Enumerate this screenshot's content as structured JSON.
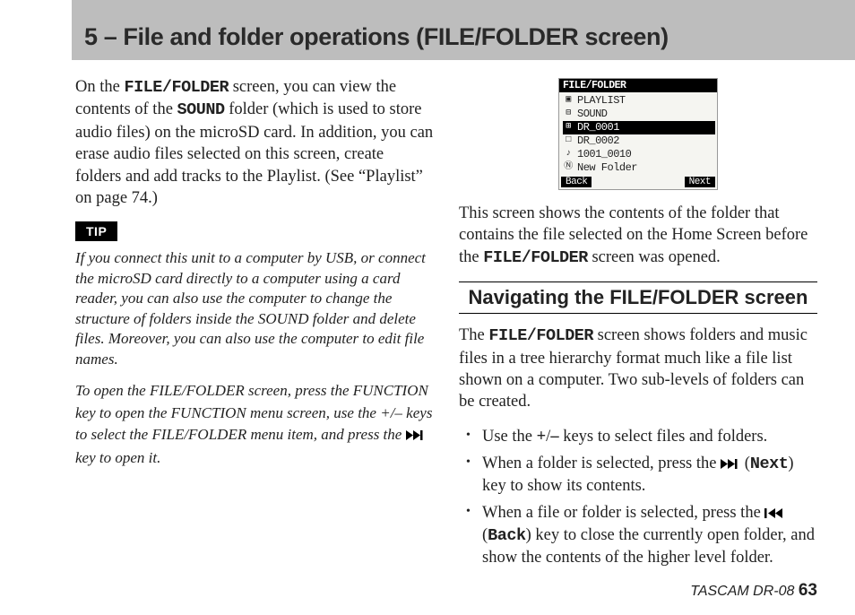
{
  "header": {
    "title": "5 – File and folder operations (FILE/FOLDER screen)"
  },
  "left": {
    "intro_pre": "On the ",
    "intro_mono1": "FILE/FOLDER",
    "intro_mid1": " screen, you can view the contents of the ",
    "intro_mono2": "SOUND",
    "intro_post": " folder (which is used to store audio files) on the microSD card. In addition, you can erase audio files selected on this screen, create folders and add tracks to the Playlist. (See “Playlist” on page 74.)",
    "tip_label": "TIP",
    "tip_body1": "If you connect this unit to a computer by USB, or connect the microSD card directly to a computer using a card reader, you can also use the computer to change the structure of folders inside the SOUND folder and delete files. Moreover, you can also use the computer to edit file names.",
    "tip_body2_pre": "To open the FILE/FOLDER screen, press the FUNCTION key to open the FUNCTION menu screen, use the +/– keys to select the FILE/FOLDER menu item, and press the ",
    "tip_body2_post": " key to open it."
  },
  "lcd": {
    "title": "FILE/FOLDER",
    "rows": [
      {
        "icon": "▣",
        "label": "PLAYLIST",
        "sel": false
      },
      {
        "icon": "⊟",
        "label": "SOUND",
        "sel": false
      },
      {
        "icon": "⊞",
        "label": "DR_0001",
        "sel": true
      },
      {
        "icon": "□",
        "label": "DR_0002",
        "sel": false
      },
      {
        "icon": "♪",
        "label": "1001_0010",
        "sel": false
      },
      {
        "icon": "Ⓝ",
        "label": "New Folder",
        "sel": false
      }
    ],
    "back": "Back",
    "next": "Next"
  },
  "right": {
    "caption_pre": "This screen shows the contents of the folder that contains the file selected on the Home Screen before the ",
    "caption_mono": "FILE/FOLDER",
    "caption_post": " screen was opened.",
    "section_title": "Navigating the FILE/FOLDER screen",
    "nav_body_pre": "The ",
    "nav_body_mono": "FILE/FOLDER",
    "nav_body_post": " screen shows folders and music files in a tree hierarchy format much like a file list shown on a computer. Two sub-levels of folders can be created.",
    "b1_pre": "Use the ",
    "b1_plus": "+",
    "b1_slash": "/",
    "b1_minus": "–",
    "b1_post": " keys to select files and folders.",
    "b2_pre": "When a folder is selected, press the ",
    "b2_paren_pre": " (",
    "b2_mono": "Next",
    "b2_post": ") key to show its contents.",
    "b3_pre": "When a file or folder is selected, press the ",
    "b3_paren_pre": " (",
    "b3_mono": "Back",
    "b3_post": ") key to close the currently open folder, and show the contents of the higher level folder."
  },
  "footer": {
    "product": "TASCAM  DR-08",
    "page": "63"
  }
}
